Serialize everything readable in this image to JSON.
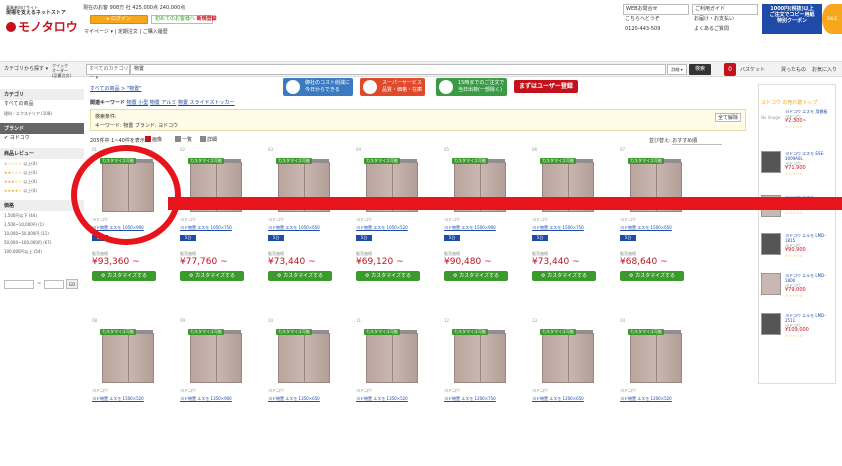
{
  "header": {
    "tagline": "事業者向けサイト",
    "tagline2": "現場を支えるネットストア",
    "logo_text": "モノタロウ",
    "promo_line": "現在のお客 908万 社 425,000点 240,000点",
    "login_label": "▸ ログイン",
    "first_label": "初めてのお客様へ",
    "new_register": "新規登録",
    "mypage_links": "マイページ ▾ | 定期注文 | ご購入履歴",
    "contact_label": "WEBお問合せ",
    "contact_sub": "こちらへどうぞ",
    "phone": "0120-443-509",
    "guide_label": "ご利用ガイド",
    "guide_sub": "お届け・お支払い",
    "guide_sub2": "よくあるご質問",
    "coupon_text": "1000円(税抜)以上\nご注文でコピー用紙\n特別クーポン",
    "coupon2_text": "SALE"
  },
  "banners": [
    {
      "label": "御社のコスト削減に",
      "sub": "今日からできる"
    },
    {
      "label": "スーパーサービス",
      "sub": "品質・価格・在庫"
    },
    {
      "label": "15時までのご注文で",
      "sub": "当日出荷(一部除く)"
    }
  ],
  "banner_cta": "まずはユーザー登録",
  "search": {
    "category_button": "カテゴリから探す ▾",
    "quick_order": "クイック\nオーダー\n(品番注文)",
    "category_select": "すべてのカテゴリー ▾",
    "query": "物置",
    "filter_label": "詳細 ▾",
    "search_button": "検索",
    "cart_count": "0",
    "cart_label": "バスケット",
    "buy_again": "買ったもの",
    "favorites": "お気に入り"
  },
  "sidebar": {
    "category_header": "カテゴリ",
    "all_products": "すべての商品",
    "category_item": "理科・エクステリア",
    "category_count": "(108)",
    "brand_header": "ブランド",
    "brand_item": "✔ ヨドコウ",
    "review_header": "商品レビュー",
    "reviews": [
      {
        "stars": "★☆☆☆☆",
        "label": "以上",
        "count": "(4)"
      },
      {
        "stars": "★★☆☆☆",
        "label": "以上",
        "count": "(4)"
      },
      {
        "stars": "★★★☆☆",
        "label": "以上",
        "count": "(4)"
      },
      {
        "stars": "★★★★☆",
        "label": "以上",
        "count": "(4)"
      }
    ],
    "price_header": "価格",
    "prices": [
      {
        "label": "1,500円以下",
        "count": "(44)"
      },
      {
        "label": "1,500~10,000円",
        "count": "(1)"
      },
      {
        "label": "10,000~50,000円",
        "count": "(11)"
      },
      {
        "label": "50,000~100,000円",
        "count": "(67)"
      },
      {
        "label": "100,000円以上",
        "count": "(54)"
      }
    ],
    "price_tilde": "~",
    "price_go": "GO"
  },
  "main": {
    "breadcrumb": "すべての商品 > \"物置\"",
    "related_label": "関連キーワード",
    "related": [
      "物置 小型",
      "物置 アルミ",
      "物置 スライドストッカー"
    ],
    "cond_label": "検索条件:",
    "cond_value": "キーワード: 物置  ブランド: ヨドコウ",
    "cond_clear": "全て解除",
    "count_text": "205件中 1~40件を表示",
    "view_image": "画像",
    "view_list": "一覧",
    "view_detail": "詳細",
    "sort_label": "並び替え:",
    "sort_value": "おすすめ順"
  },
  "products_row1": [
    {
      "num": "01",
      "maker": "ヨドコウ",
      "name": "ヨド物置 エスモ 1050×900",
      "days": "5日",
      "price": "¥93,360 ~"
    },
    {
      "num": "02",
      "maker": "ヨドコウ",
      "name": "ヨド物置 エスモ 1050×750",
      "days": "5日",
      "price": "¥77,760 ~"
    },
    {
      "num": "03",
      "maker": "ヨドコウ",
      "name": "ヨド物置 エスモ 1050×650",
      "days": "5日",
      "price": "¥73,440 ~"
    },
    {
      "num": "04",
      "maker": "ヨドコウ",
      "name": "ヨド物置 エスモ 1050×520",
      "days": "5日",
      "price": "¥69,120 ~"
    },
    {
      "num": "05",
      "maker": "ヨドコウ",
      "name": "ヨド物置 エスモ 1500×900",
      "days": "5日",
      "price": "¥90,480 ~"
    },
    {
      "num": "06",
      "maker": "ヨドコウ",
      "name": "ヨド物置 エスモ 1500×750",
      "days": "5日",
      "price": "¥73,440 ~"
    },
    {
      "num": "07",
      "maker": "ヨドコウ",
      "name": "ヨド物置 エスモ 1500×650",
      "days": "5日",
      "price": "¥68,640 ~"
    }
  ],
  "products_row2": [
    {
      "num": "08",
      "maker": "ヨドコウ",
      "name": "ヨド物置 エスモ 1500×520"
    },
    {
      "num": "09",
      "maker": "ヨドコウ",
      "name": "ヨド物置 エスモ 1350×900"
    },
    {
      "num": "10",
      "maker": "ヨドコウ",
      "name": "ヨド物置 エスモ 1350×650"
    },
    {
      "num": "11",
      "maker": "ヨドコウ",
      "name": "ヨド物置 エスモ 1350×520"
    },
    {
      "num": "12",
      "maker": "ヨドコウ",
      "name": "ヨド物置 エスモ 1200×750"
    },
    {
      "num": "13",
      "maker": "ヨドコウ",
      "name": "ヨド物置 エスモ 1200×650"
    },
    {
      "num": "14",
      "maker": "ヨドコウ",
      "name": "ヨド物置 エスモ 1200×520"
    }
  ],
  "common": {
    "badge": "カスタマイズ可能",
    "price_label": "販売価格",
    "customize_button": "カスタマイズする"
  },
  "right_panel": {
    "title": "ヨドコウ の売れ筋トップ",
    "items": [
      {
        "name": "ヨドコウ エスモ 用棚板",
        "maker": "ヨドコウ",
        "price": "¥2,300~",
        "stars": "☆☆☆☆☆",
        "noimg": "No Image"
      },
      {
        "name": "ヨドコウ エスモ ESE-1009A0L",
        "maker": "ヨドコウ",
        "price": "¥71,900",
        "stars": "☆☆☆☆☆"
      },
      {
        "name": "ヨドコウ エスモ",
        "maker": "ヨドコウ",
        "price": "¥38,900",
        "stars": "☆☆☆☆☆"
      },
      {
        "name": "ヨドコウ エルモ LMD-1815",
        "maker": "ヨドコウ",
        "price": "¥90,900",
        "stars": "☆☆☆☆☆"
      },
      {
        "name": "ヨドコウ エルモ LMD-1800",
        "maker": "ヨドコウ",
        "price": "¥79,000",
        "stars": "☆☆☆☆☆"
      },
      {
        "name": "ヨドコウ エルモ LMD-2511",
        "maker": "ヨドコウ",
        "price": "¥109,000",
        "stars": "☆☆☆☆☆"
      }
    ]
  },
  "colors": {
    "brand_red": "#c3121b",
    "customize_green": "#3a9a2b",
    "annotation_red": "#e8141b"
  }
}
